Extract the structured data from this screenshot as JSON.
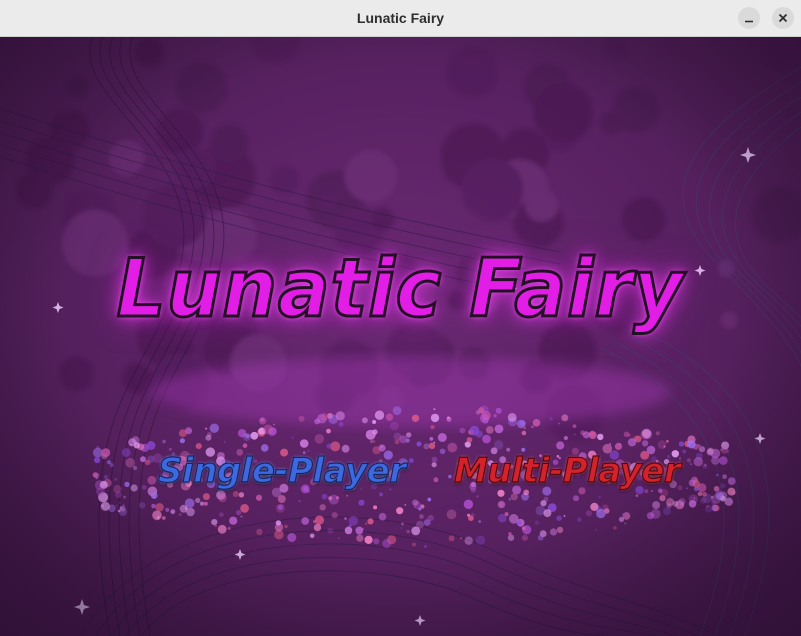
{
  "window": {
    "title": "Lunatic Fairy",
    "minimize_icon": "minimize-icon",
    "close_icon": "close-icon"
  },
  "game": {
    "title": "Lunatic Fairy",
    "menu": {
      "single_player": "Single-Player",
      "multi_player": "Multi-Player"
    }
  },
  "colors": {
    "background": "#5a2263",
    "title": "#e21ee6",
    "single_player": "#3e68e0",
    "multi_player": "#d4222d"
  }
}
